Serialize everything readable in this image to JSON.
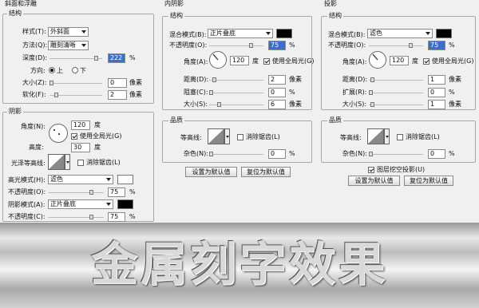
{
  "bevel": {
    "section_title": "斜面和浮雕",
    "structure_legend": "结构",
    "style_label": "样式(T):",
    "style_value": "外斜面",
    "method_label": "方法(Q):",
    "method_value": "雕刻清晰",
    "depth_label": "深度(D):",
    "depth_value": "222",
    "depth_unit": "%",
    "direction_label": "方向:",
    "dir_up": "上",
    "dir_down": "下",
    "size_label": "大小(Z):",
    "size_value": "0",
    "size_unit": "像素",
    "soften_label": "软化(F):",
    "soften_value": "2",
    "soften_unit": "像素",
    "shading_legend": "阴影",
    "angle_label": "角度(N):",
    "angle_value": "120",
    "angle_unit": "度",
    "global_light_label": "使用全局光(G)",
    "altitude_label": "高度:",
    "altitude_value": "30",
    "altitude_unit": "度",
    "gloss_label": "光泽等高线:",
    "anti_alias_label": "消除锯齿(L)",
    "highlight_mode_label": "高光模式(H):",
    "highlight_mode_value": "滤色",
    "highlight_opacity_label": "不透明度(O):",
    "highlight_opacity_value": "75",
    "shadow_mode_label": "阴影模式(A):",
    "shadow_mode_value": "正片叠底",
    "shadow_opacity_label": "不透明度(C):",
    "shadow_opacity_value": "75",
    "percent": "%"
  },
  "inner_shadow": {
    "section_title": "内阴影",
    "structure_legend": "结构",
    "blend_label": "混合模式(B):",
    "blend_value": "正片叠底",
    "opacity_label": "不透明度(O):",
    "opacity_value": "75",
    "angle_label": "角度(A):",
    "angle_value": "120",
    "angle_unit": "度",
    "global_light_label": "使用全局光(G)",
    "distance_label": "距离(D):",
    "distance_value": "2",
    "choke_label": "阻塞(C):",
    "choke_value": "0",
    "size_label": "大小(S):",
    "size_value": "6",
    "px": "像素",
    "percent": "%",
    "quality_legend": "品质",
    "contour_label": "等高线:",
    "anti_alias_label": "消除锯齿(L)",
    "noise_label": "杂色(N):",
    "noise_value": "0",
    "make_default": "设置为默认值",
    "reset_default": "复位为默认值"
  },
  "drop_shadow": {
    "section_title": "投影",
    "structure_legend": "结构",
    "blend_label": "混合模式(B):",
    "blend_value": "滤色",
    "opacity_label": "不透明度(O):",
    "opacity_value": "75",
    "angle_label": "角度(A):",
    "angle_value": "120",
    "angle_unit": "度",
    "global_light_label": "使用全局光(G)",
    "distance_label": "距离(D):",
    "distance_value": "1",
    "spread_label": "扩展(R):",
    "spread_value": "0",
    "size_label": "大小(S):",
    "size_value": "1",
    "px": "像素",
    "percent": "%",
    "quality_legend": "品质",
    "contour_label": "等高线:",
    "anti_alias_label": "消除锯齿(L)",
    "noise_label": "杂色(N):",
    "noise_value": "0",
    "knockout_label": "图层挖空投影(U)",
    "make_default": "设置为默认值",
    "reset_default": "复位为默认值"
  },
  "banner_title": "金属刻字效果"
}
